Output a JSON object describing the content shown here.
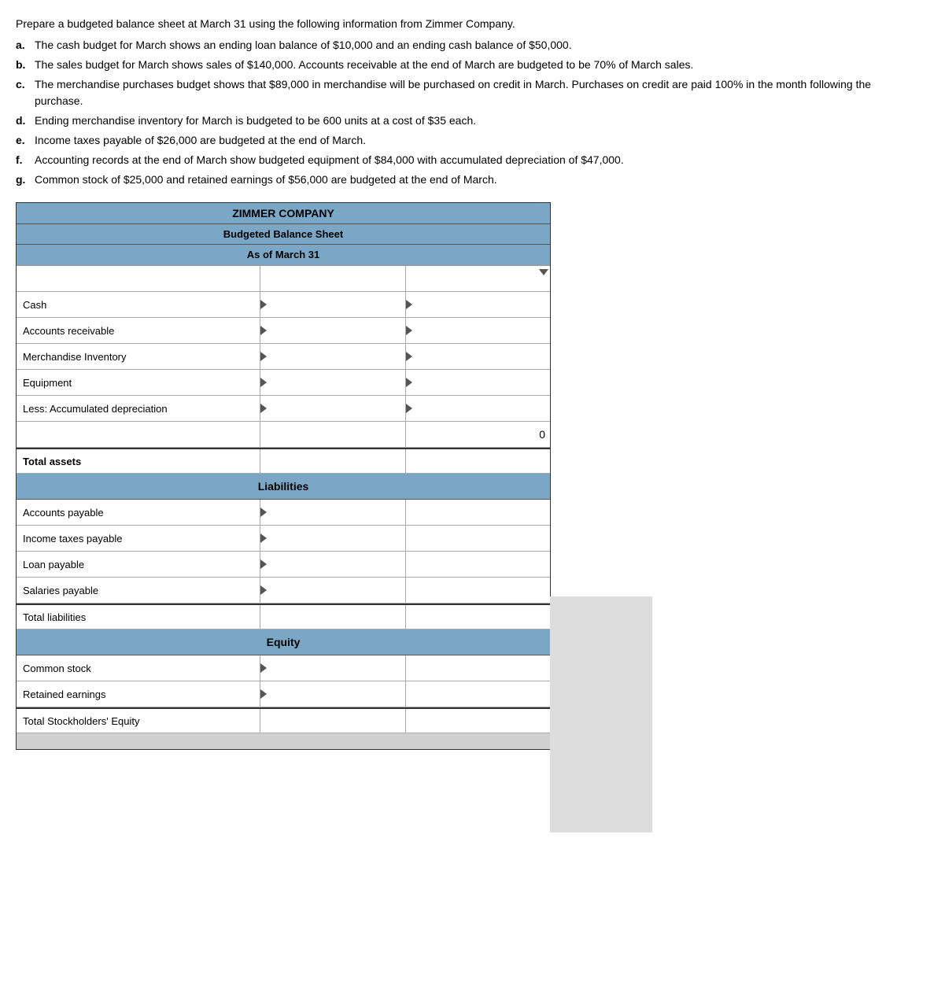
{
  "intro": {
    "prefix": "Prepare a budgeted balance sheet at March 31 using the following information from Zimmer Company.",
    "items": [
      {
        "label": "a.",
        "text": "The cash budget for March shows an ending loan balance of $10,000 and an ending cash balance of $50,000."
      },
      {
        "label": "b.",
        "text": "The sales budget for March shows sales of $140,000. Accounts receivable at the end of March are budgeted to be 70% of March sales."
      },
      {
        "label": "c.",
        "text": "The merchandise purchases budget shows that $89,000 in merchandise will be purchased on credit in March. Purchases on credit are paid 100% in the month following the purchase."
      },
      {
        "label": "d.",
        "text": "Ending merchandise inventory for March is budgeted to be 600 units at a cost of $35 each."
      },
      {
        "label": "e.",
        "text": "Income taxes payable of $26,000 are budgeted at the end of March."
      },
      {
        "label": "f.",
        "text": "Accounting records at the end of March show budgeted equipment of $84,000 with accumulated depreciation of $47,000."
      },
      {
        "label": "g.",
        "text": "Common stock of $25,000 and retained earnings of $56,000 are budgeted at the end of March."
      }
    ]
  },
  "table": {
    "company": "ZIMMER COMPANY",
    "title": "Budgeted Balance Sheet",
    "date": "As of March 31",
    "assets": {
      "rows": [
        {
          "label": "Cash",
          "col1": "",
          "col2": ""
        },
        {
          "label": "Accounts receivable",
          "col1": "",
          "col2": ""
        },
        {
          "label": "Merchandise Inventory",
          "col1": "",
          "col2": ""
        },
        {
          "label": "Equipment",
          "col1": "",
          "col2": ""
        },
        {
          "label": "Less: Accumulated depreciation",
          "col1": "",
          "col2": ""
        }
      ],
      "spacer_col2": "0",
      "total_label": "Total assets",
      "total_col1": "",
      "total_col2": ""
    },
    "liabilities": {
      "header": "Liabilities",
      "rows": [
        {
          "label": "Accounts payable",
          "col1": "",
          "col2": ""
        },
        {
          "label": "Income taxes payable",
          "col1": "",
          "col2": ""
        },
        {
          "label": "Loan payable",
          "col1": "",
          "col2": ""
        },
        {
          "label": "Salaries payable",
          "col1": "",
          "col2": ""
        }
      ],
      "total_label": "Total liabilities",
      "total_col1": "",
      "total_col2": ""
    },
    "equity": {
      "header": "Equity",
      "rows": [
        {
          "label": "Common stock",
          "col1": "",
          "col2": ""
        },
        {
          "label": "Retained earnings",
          "col1": "",
          "col2": ""
        }
      ],
      "total_label": "Total Stockholders' Equity",
      "total_col1": "",
      "total_col2": ""
    }
  }
}
